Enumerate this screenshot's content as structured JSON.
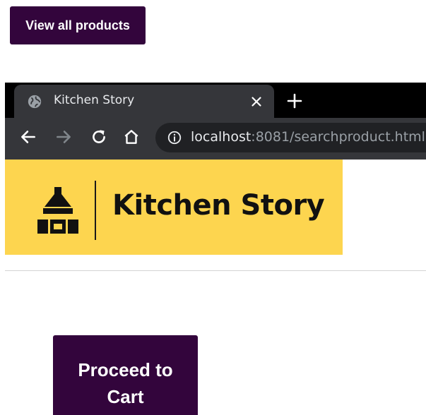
{
  "actions": {
    "view_all_label": "View all products",
    "proceed_line1": "Proceed to",
    "proceed_line2": "Cart"
  },
  "browser": {
    "tab_title": "Kitchen Story",
    "url_host": "localhost",
    "url_rest": ":8081/searchproduct.html",
    "icons": [
      "globe-icon",
      "close-icon",
      "plus-icon",
      "back-arrow-icon",
      "forward-arrow-icon",
      "reload-icon",
      "home-icon",
      "info-icon"
    ]
  },
  "brand": {
    "name": "Kitchen Story",
    "banner_color": "#fdd54f"
  },
  "colors": {
    "button": "#33053c",
    "button_text": "#ffffff"
  }
}
